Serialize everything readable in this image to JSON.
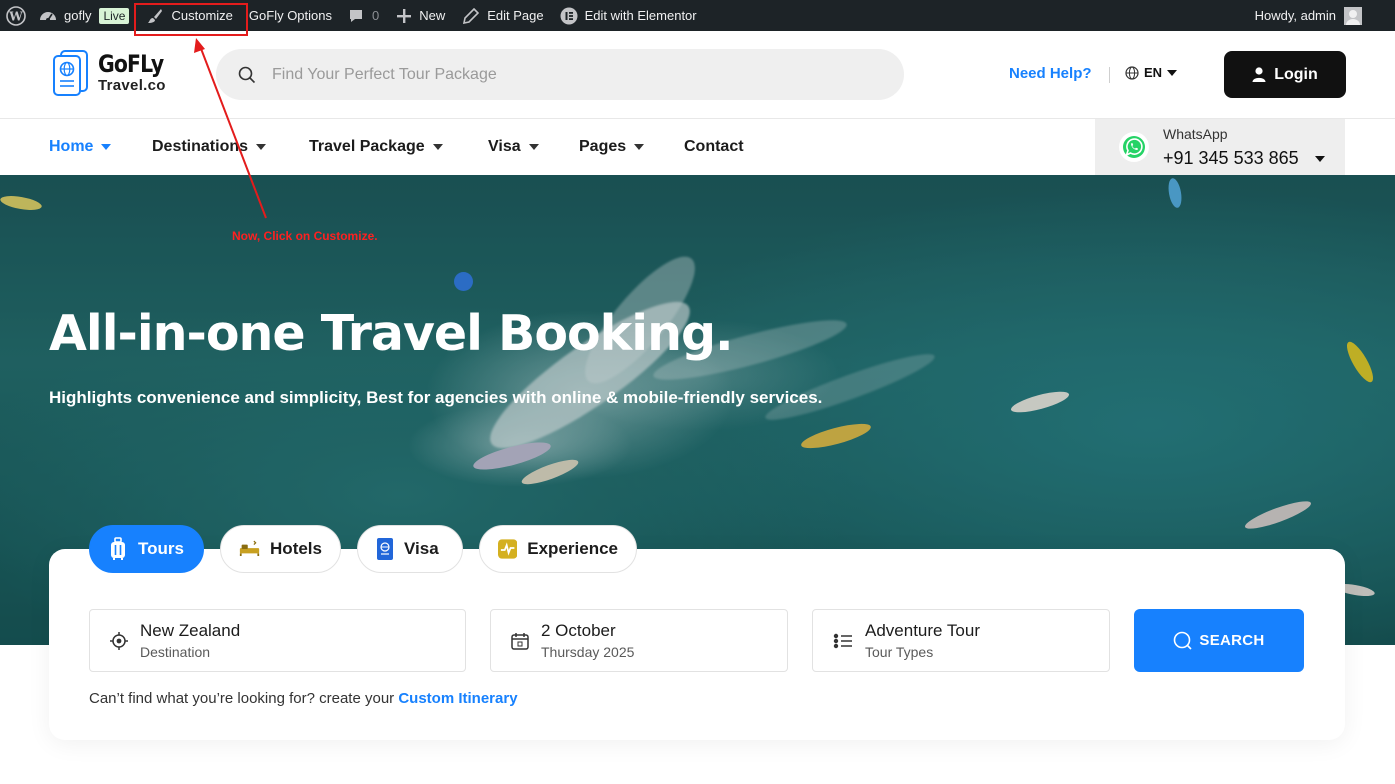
{
  "admin_bar": {
    "site_name": "gofly",
    "live_badge": "Live",
    "customize": "Customize",
    "gofly_options": "GoFly Options",
    "comments_count": "0",
    "new": "New",
    "edit_page": "Edit Page",
    "edit_elementor": "Edit with Elementor",
    "howdy": "Howdy, admin"
  },
  "header": {
    "logo_name": "GoFLy",
    "logo_sub": "Travel.co",
    "search_placeholder": "Find Your Perfect Tour Package",
    "need_help": "Need Help?",
    "language": "EN",
    "login": "Login"
  },
  "nav": {
    "items": [
      {
        "label": "Home",
        "active": true,
        "has_dropdown": true
      },
      {
        "label": "Destinations",
        "active": false,
        "has_dropdown": true
      },
      {
        "label": "Travel Package",
        "active": false,
        "has_dropdown": true
      },
      {
        "label": "Visa",
        "active": false,
        "has_dropdown": true
      },
      {
        "label": "Pages",
        "active": false,
        "has_dropdown": true
      },
      {
        "label": "Contact",
        "active": false,
        "has_dropdown": false
      }
    ],
    "whatsapp_label": "WhatsApp",
    "whatsapp_number": "+91 345 533 865"
  },
  "hero": {
    "annotation": "Now, Click on Customize.",
    "title": "All-in-one Travel Booking.",
    "subtitle": "Highlights convenience and simplicity, Best for agencies with online & mobile-friendly services."
  },
  "booking": {
    "tabs": [
      {
        "label": "Tours",
        "icon": "luggage-icon",
        "active": true
      },
      {
        "label": "Hotels",
        "icon": "bed-icon",
        "active": false
      },
      {
        "label": "Visa",
        "icon": "passport-icon",
        "active": false
      },
      {
        "label": "Experience",
        "icon": "activity-icon",
        "active": false
      }
    ],
    "destination": {
      "value": "New Zealand",
      "label": "Destination"
    },
    "date": {
      "value": "2 October",
      "label": "Thursday 2025"
    },
    "tour_type": {
      "value": "Adventure Tour",
      "label": "Tour Types"
    },
    "search_button": "SEARCH",
    "custom_text": "Can’t find what you’re looking for? create your",
    "custom_link": "Custom Itinerary"
  },
  "colors": {
    "accent": "#1781fe",
    "admin_bar_bg": "#1d2327",
    "annotation": "#ff2020"
  }
}
